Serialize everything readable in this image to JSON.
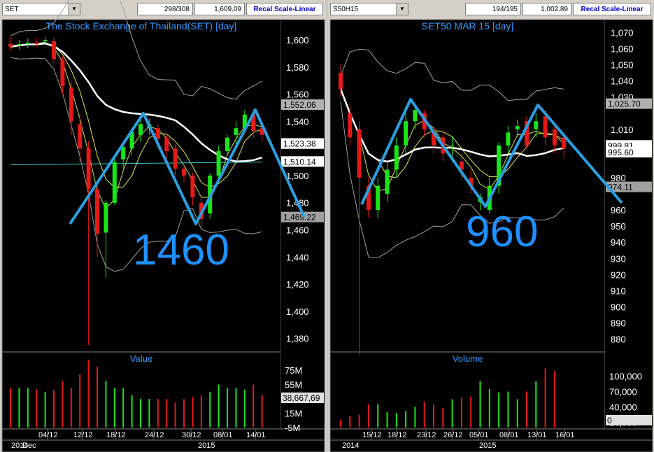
{
  "left": {
    "symbol": "SET",
    "count": "298/308",
    "price": "1,609.09",
    "scale_button": "Recal Scale-Linear",
    "title": "The Stock Exchange of Thailand(SET) [day]",
    "sub_title": "Value",
    "annotation": "1460",
    "price_labels": [
      "1,600",
      "1,580",
      "1,560",
      "1,540",
      "1,500",
      "1,480",
      "1,460",
      "1,440",
      "1,420",
      "1,400",
      "1,380"
    ],
    "tags": [
      "1,552.06",
      "1,523.38",
      "1,510.14",
      "1,469.22",
      "1,523.38"
    ],
    "sub_labels": [
      "75M",
      "55M",
      "35M",
      "15M",
      "-5M"
    ],
    "sub_tag": "38,667,69",
    "date_labels": [
      "04/12",
      "12/12",
      "18/12",
      "24/12",
      "30/12",
      "08/01",
      "14/01"
    ],
    "month_labels": [
      "2014",
      "Dec",
      "2015"
    ]
  },
  "right": {
    "symbol": "S50H15",
    "count": "194/195",
    "price": "1,002.89",
    "scale_button": "Recal Scale-Linear",
    "title": "SET50 MAR 15   [day]",
    "sub_title": "Volume",
    "annotation": "960",
    "price_labels": [
      "1,070",
      "1,060",
      "1,050",
      "1,040",
      "1,030",
      "1,010",
      "980",
      "960",
      "950",
      "940",
      "930",
      "920",
      "910",
      "900",
      "890",
      "880"
    ],
    "tags": [
      "1,025.70",
      "999.81",
      "995.60",
      "974.11"
    ],
    "sub_labels": [
      "100,000",
      "70,000",
      "40,000",
      "10,000"
    ],
    "sub_tag": "0",
    "date_labels": [
      "15/12",
      "18/12",
      "23/12",
      "26/12",
      "05/01",
      "08/01",
      "13/01",
      "16/01"
    ],
    "month_labels": [
      "2014",
      "2015"
    ]
  },
  "chart_data": [
    {
      "type": "candlestick",
      "title": "The Stock Exchange of Thailand(SET) [day]",
      "ylim": [
        1370,
        1615
      ],
      "x": [
        "2014-11-27",
        "2014-11-28",
        "2014-12-01",
        "2014-12-02",
        "2014-12-03",
        "2014-12-04",
        "2014-12-08",
        "2014-12-09",
        "2014-12-11",
        "2014-12-12",
        "2014-12-15",
        "2014-12-16",
        "2014-12-17",
        "2014-12-18",
        "2014-12-19",
        "2014-12-22",
        "2014-12-23",
        "2014-12-24",
        "2014-12-25",
        "2014-12-26",
        "2014-12-29",
        "2014-12-30",
        "2015-01-05",
        "2015-01-06",
        "2015-01-07",
        "2015-01-08",
        "2015-01-09",
        "2015-01-12",
        "2015-01-13",
        "2015-01-14"
      ],
      "open": [
        1597,
        1596,
        1597,
        1598,
        1599,
        1599,
        1585,
        1565,
        1538,
        1520,
        1490,
        1458,
        1480,
        1512,
        1520,
        1530,
        1535,
        1535,
        1528,
        1520,
        1505,
        1500,
        1480,
        1472,
        1500,
        1518,
        1530,
        1535,
        1545,
        1535
      ],
      "close": [
        1595,
        1597,
        1598,
        1597,
        1600,
        1586,
        1566,
        1540,
        1520,
        1490,
        1457,
        1480,
        1510,
        1521,
        1532,
        1538,
        1538,
        1527,
        1518,
        1505,
        1500,
        1484,
        1468,
        1500,
        1518,
        1528,
        1535,
        1545,
        1533,
        1530
      ],
      "high": [
        1602,
        1600,
        1601,
        1601,
        1602,
        1602,
        1588,
        1570,
        1545,
        1525,
        1495,
        1482,
        1515,
        1525,
        1535,
        1541,
        1542,
        1538,
        1530,
        1523,
        1508,
        1502,
        1485,
        1502,
        1522,
        1530,
        1540,
        1548,
        1550,
        1538
      ],
      "low": [
        1592,
        1593,
        1594,
        1595,
        1596,
        1583,
        1560,
        1530,
        1510,
        1375,
        1440,
        1425,
        1478,
        1505,
        1515,
        1525,
        1530,
        1520,
        1510,
        1500,
        1495,
        1478,
        1462,
        1468,
        1498,
        1515,
        1522,
        1532,
        1528,
        1525
      ],
      "series": [
        {
          "name": "value",
          "values": [
            50,
            50,
            50,
            48,
            45,
            47,
            60,
            50,
            70,
            90,
            80,
            60,
            50,
            50,
            40,
            35,
            35,
            35,
            35,
            30,
            35,
            38,
            40,
            45,
            55,
            50,
            50,
            48,
            55,
            40
          ]
        }
      ]
    },
    {
      "type": "candlestick",
      "title": "SET50 MAR 15   [day]",
      "ylim": [
        872,
        1078
      ],
      "x": [
        "2014-12-09",
        "2014-12-10",
        "2014-12-11",
        "2014-12-12",
        "2014-12-15",
        "2014-12-16",
        "2014-12-17",
        "2014-12-18",
        "2014-12-19",
        "2014-12-22",
        "2014-12-23",
        "2014-12-24",
        "2014-12-25",
        "2014-12-26",
        "2014-12-29",
        "2014-12-30",
        "2015-01-05",
        "2015-01-06",
        "2015-01-07",
        "2015-01-08",
        "2015-01-09",
        "2015-01-12",
        "2015-01-13",
        "2015-01-14",
        "2015-01-15"
      ],
      "open": [
        1045,
        1020,
        1010,
        975,
        960,
        970,
        985,
        1000,
        1015,
        1020,
        1010,
        1005,
        1000,
        990,
        980,
        965,
        960,
        975,
        1000,
        1010,
        1015,
        1010,
        1018,
        1010,
        1005
      ],
      "close": [
        1035,
        1005,
        980,
        960,
        975,
        985,
        1000,
        1015,
        1022,
        1010,
        1000,
        995,
        1000,
        985,
        975,
        968,
        975,
        1000,
        1008,
        1012,
        1000,
        1015,
        1005,
        1000,
        998
      ],
      "high": [
        1050,
        1025,
        1015,
        980,
        980,
        990,
        1005,
        1020,
        1026,
        1022,
        1012,
        1008,
        1006,
        995,
        985,
        970,
        980,
        1002,
        1012,
        1016,
        1018,
        1020,
        1022,
        1014,
        1008
      ],
      "low": [
        1030,
        1000,
        870,
        955,
        955,
        965,
        980,
        995,
        1010,
        1005,
        995,
        990,
        990,
        980,
        970,
        960,
        958,
        970,
        995,
        1005,
        998,
        1005,
        1000,
        995,
        992
      ],
      "series": [
        {
          "name": "Volume",
          "values": [
            15000,
            22000,
            25000,
            45000,
            45000,
            30000,
            28000,
            32000,
            40000,
            50000,
            45000,
            38000,
            55000,
            58000,
            60000,
            90000,
            75000,
            68000,
            70000,
            55000,
            70000,
            90000,
            115000,
            110000,
            0
          ]
        }
      ]
    }
  ]
}
